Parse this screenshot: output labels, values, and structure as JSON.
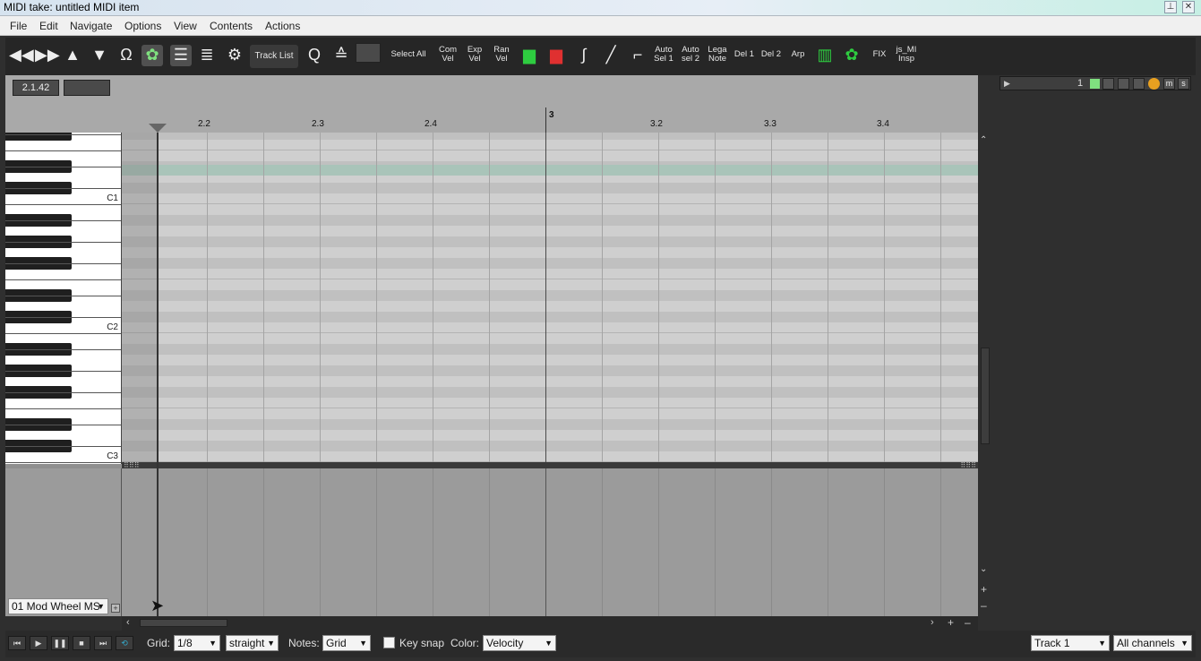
{
  "window": {
    "title": "MIDI take: untitled MIDI item"
  },
  "menu": [
    "File",
    "Edit",
    "Navigate",
    "Options",
    "View",
    "Contents",
    "Actions"
  ],
  "toolbar": {
    "track_list": "Track List",
    "select_all": "Select All",
    "com_vel": [
      "Com",
      "Vel"
    ],
    "exp_vel": [
      "Exp",
      "Vel"
    ],
    "ran_vel": [
      "Ran",
      "Vel"
    ],
    "auto_sel1": [
      "Auto",
      "Sel 1"
    ],
    "auto_sel2": [
      "Auto",
      "sel 2"
    ],
    "lega_note": [
      "Lega",
      "Note"
    ],
    "del1": "Del 1",
    "del2": "Del 2",
    "arp": "Arp",
    "fix": "FIX",
    "js_mi": [
      "js_MI",
      "Insp"
    ]
  },
  "position": "2.1.42",
  "ruler": [
    "2.2",
    "2.3",
    "2.4",
    "3",
    "3.2",
    "3.3",
    "3.4"
  ],
  "keys": [
    "C3",
    "C2",
    "C1"
  ],
  "cc_lane": {
    "selected": "01 Mod Wheel MS"
  },
  "track_panel": {
    "number": "1"
  },
  "bottom": {
    "grid_label": "Grid:",
    "grid_value": "1/8",
    "grid_type": "straight",
    "notes_label": "Notes:",
    "notes_value": "Grid",
    "keysnap_label": "Key snap",
    "color_label": "Color:",
    "color_value": "Velocity",
    "track_value": "Track 1",
    "channels_value": "All channels"
  },
  "colors": {
    "accent_green": "#2ecc40",
    "accent_red": "#e03030",
    "highlight_row": "#a9c4b9"
  }
}
